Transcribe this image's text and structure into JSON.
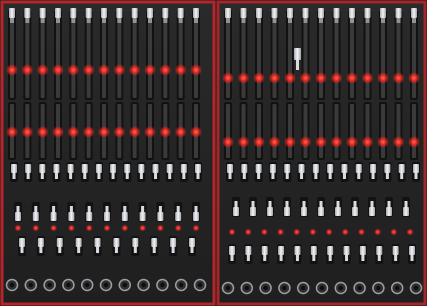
{
  "scene": {
    "description_label": "",
    "colors": {
      "background": "#1c1c1c",
      "tray_frame": "#b3262b",
      "divider": "#a3262a",
      "foam": "#262626",
      "foam_slot": "#121212",
      "socket_metal": "#e9ecef",
      "socket_shadow": "#8f9398",
      "red_marker": "#ff3b32",
      "red_glow": "#ff2a22"
    },
    "panels": [
      {
        "name": "left-tray",
        "rows": [
          "upper-socket-row",
          "middle-socket-row",
          "bit-socket-row",
          "lower-bit-row",
          "round-socket-row"
        ]
      },
      {
        "name": "right-tray",
        "rows": [
          "upper-socket-row",
          "middle-socket-row",
          "bit-socket-row",
          "lower-bit-row",
          "round-socket-row"
        ]
      }
    ]
  }
}
